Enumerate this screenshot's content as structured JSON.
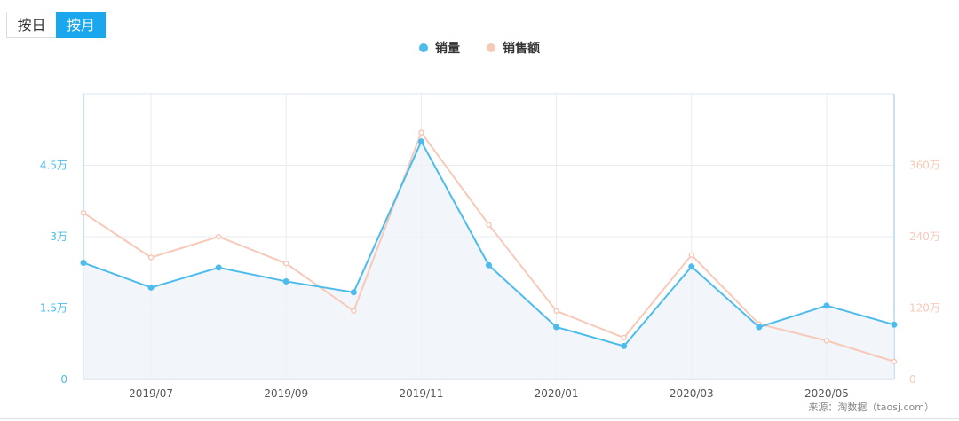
{
  "toggle": {
    "day_label": "按日",
    "month_label": "按月",
    "selected": "month"
  },
  "source": "来源：淘数据（taosj.com）",
  "colors": {
    "sales": "#4dbcec",
    "revenue": "#f7c9b9",
    "toggle_active": "#1aa7ee"
  },
  "chart_data": {
    "type": "line",
    "title": "",
    "x": [
      "2019/06",
      "2019/07",
      "2019/08",
      "2019/09",
      "2019/10",
      "2019/11",
      "2019/12",
      "2020/01",
      "2020/02",
      "2020/03",
      "2020/04",
      "2020/05",
      "2020/06"
    ],
    "x_tick_labels": [
      "2019/07",
      "2019/09",
      "2019/11",
      "2020/01",
      "2020/03",
      "2020/05"
    ],
    "series": [
      {
        "name": "销量",
        "axis": "left",
        "color": "#4dbcec",
        "area": true,
        "values": [
          24500,
          19300,
          23500,
          20600,
          18300,
          50000,
          24000,
          11000,
          7000,
          23700,
          11000,
          15500,
          11500
        ]
      },
      {
        "name": "销售额",
        "axis": "right",
        "color": "#f7c9b9",
        "area": false,
        "values": [
          2800000,
          2050000,
          2400000,
          1950000,
          1150000,
          4150000,
          2600000,
          1150000,
          700000,
          2090000,
          930000,
          650000,
          300000
        ]
      }
    ],
    "left_axis": {
      "ylim": [
        0,
        60000
      ],
      "ticks": [
        0,
        15000,
        30000,
        45000
      ],
      "tick_labels": [
        "0",
        "1.5万",
        "3万",
        "4.5万"
      ],
      "color": "#4dbcec"
    },
    "right_axis": {
      "ylim": [
        0,
        4800000
      ],
      "ticks": [
        0,
        1200000,
        2400000,
        3600000
      ],
      "tick_labels": [
        "0",
        "120万",
        "240万",
        "360万"
      ],
      "color": "#f7c9b9"
    },
    "grid": true,
    "legend": "top-center"
  }
}
